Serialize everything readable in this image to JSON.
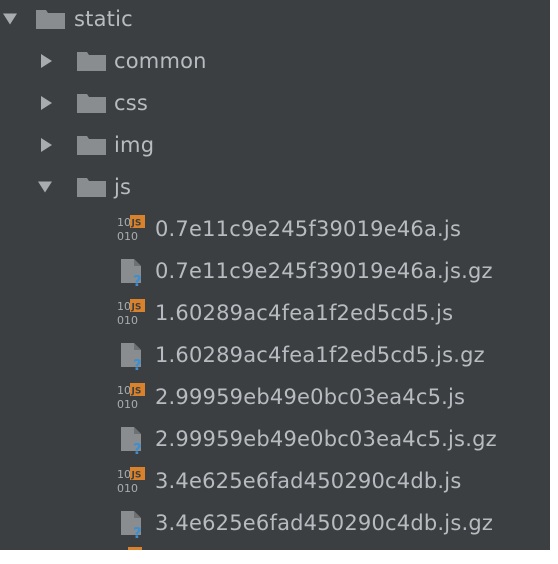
{
  "tree": {
    "root": {
      "label": "static",
      "expanded": true
    },
    "folders": [
      {
        "label": "common",
        "expanded": false
      },
      {
        "label": "css",
        "expanded": false
      },
      {
        "label": "img",
        "expanded": false
      },
      {
        "label": "js",
        "expanded": true
      }
    ],
    "files": [
      {
        "label": "0.7e11c9e245f39019e46a.js",
        "icon": "binary-js-file-icon"
      },
      {
        "label": "0.7e11c9e245f39019e46a.js.gz",
        "icon": "unknown-file-icon"
      },
      {
        "label": "1.60289ac4fea1f2ed5cd5.js",
        "icon": "binary-js-file-icon"
      },
      {
        "label": "1.60289ac4fea1f2ed5cd5.js.gz",
        "icon": "unknown-file-icon"
      },
      {
        "label": "2.99959eb49e0bc03ea4c5.js",
        "icon": "binary-js-file-icon"
      },
      {
        "label": "2.99959eb49e0bc03ea4c5.js.gz",
        "icon": "unknown-file-icon"
      },
      {
        "label": "3.4e625e6fad450290c4db.js",
        "icon": "binary-js-file-icon"
      },
      {
        "label": "3.4e625e6fad450290c4db.js.gz",
        "icon": "unknown-file-icon"
      }
    ]
  },
  "colors": {
    "background": "#3c3f41",
    "text": "#b8bcc0",
    "folder": "#8a8d90",
    "js_badge": "#d9822b",
    "question": "#3d8fd1"
  }
}
